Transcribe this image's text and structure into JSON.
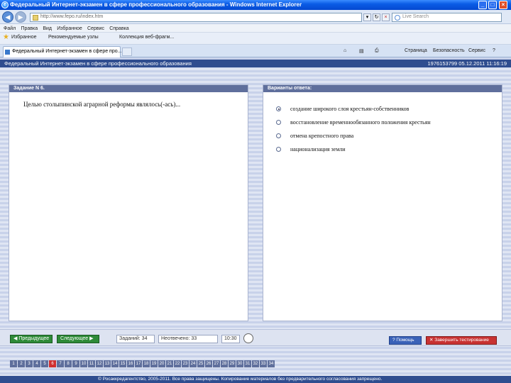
{
  "window": {
    "title": "Федеральный Интернет-экзамен в сфере профессионального образования - Windows Internet Explorer"
  },
  "addressbar": {
    "url": "http://www.fepo.ru/index.htm",
    "search_placeholder": "Live Search"
  },
  "menubar": [
    "Файл",
    "Правка",
    "Вид",
    "Избранное",
    "Сервис",
    "Справка"
  ],
  "favorites": {
    "label": "Избранное",
    "items": [
      "Рекомендуемые узлы",
      "Коллекция веб-фрагм..."
    ]
  },
  "tabs": [
    {
      "label": "Федеральный Интернет-экзамен в сфере про..."
    }
  ],
  "commandbar": [
    "Страница",
    "Безопасность",
    "Сервис"
  ],
  "site": {
    "header_title": "Федеральный Интернет-экзамен в сфере профессионального образования",
    "header_meta": "1976153799 05.12.2011 11:16:19"
  },
  "question_panel": {
    "heading": "Задание N 6.",
    "text": "Целью столыпинской аграрной реформы являлось(-ась)..."
  },
  "answers_panel": {
    "heading": "Варианты ответа:",
    "options": [
      {
        "label": "создание широкого слоя крестьян-собственников",
        "selected": true
      },
      {
        "label": "восстановление временнообязанного положения крестьян",
        "selected": false
      },
      {
        "label": "отмена крепостного права",
        "selected": false
      },
      {
        "label": "национализация земли",
        "selected": false
      }
    ]
  },
  "controls": {
    "prev_label": "Предыдущее",
    "next_label": "Следующее",
    "tasks_total": "Заданий: 34",
    "tasks_unanswered": "Неотвечено: 33",
    "timer": "10:30",
    "help_label": "Помощь",
    "finish_label": "Завершить тестирование"
  },
  "pager": {
    "current": "6",
    "pages": [
      "1",
      "2",
      "3",
      "4",
      "5",
      "6",
      "7",
      "8",
      "9",
      "10",
      "11",
      "12",
      "13",
      "14",
      "15",
      "16",
      "17",
      "18",
      "19",
      "20",
      "21",
      "22",
      "23",
      "24",
      "25",
      "26",
      "27",
      "28",
      "29",
      "30",
      "31",
      "32",
      "33",
      "34"
    ]
  },
  "footer": {
    "copyright": "© Росаккредагентство, 2005-2011. Все права защищены. Копирование материалов без предварительного согласования запрещено."
  },
  "colors": {
    "header_bg": "#2f4d8f",
    "panel_head_bg": "#5f6f9c",
    "nav_button_green": "#2e8a38",
    "help_button_blue": "#3a62b8",
    "finish_button_red": "#c83232",
    "current_page_red": "#d03030"
  }
}
